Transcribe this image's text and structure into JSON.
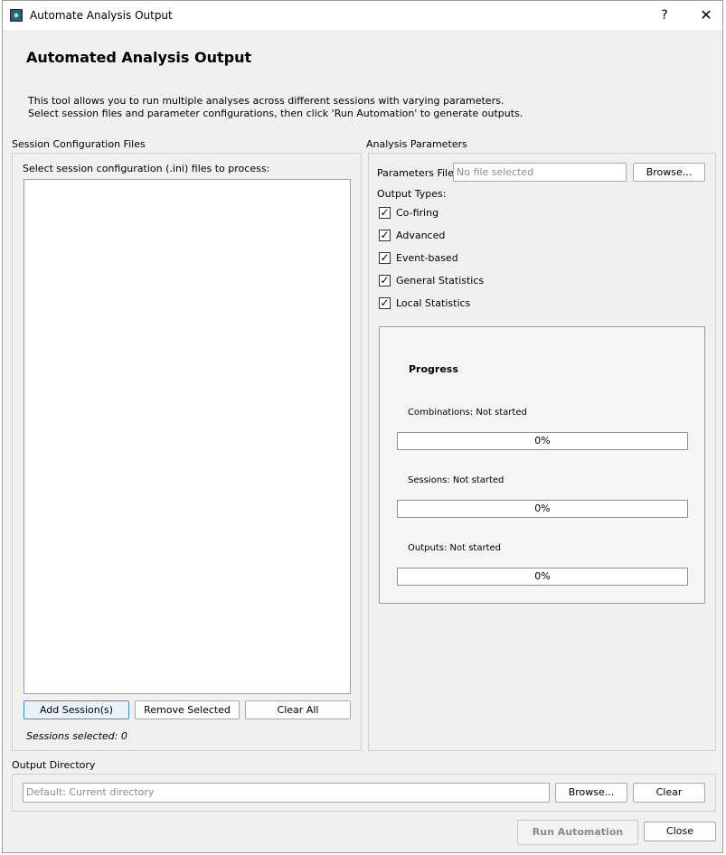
{
  "window": {
    "title": "Automate Analysis Output",
    "help_glyph": "?",
    "close_glyph": "✕"
  },
  "header": {
    "title": "Automated Analysis Output",
    "description_line1": "This tool allows you to run multiple analyses across different sessions with varying parameters.",
    "description_line2": "Select session files and parameter configurations, then click 'Run Automation' to generate outputs."
  },
  "sessions": {
    "group_label": "Session Configuration Files",
    "prompt": "Select session configuration (.ini) files to process:",
    "add_label": "Add Session(s)",
    "remove_label": "Remove Selected",
    "clear_label": "Clear All",
    "count_text": "Sessions selected: 0"
  },
  "analysis": {
    "group_label": "Analysis Parameters",
    "params_label": "Parameters File:",
    "params_placeholder": "No file selected",
    "browse_label": "Browse...",
    "output_types_label": "Output Types:",
    "output_types": [
      {
        "label": "Co-firing",
        "checked": true
      },
      {
        "label": "Advanced",
        "checked": true
      },
      {
        "label": "Event-based",
        "checked": true
      },
      {
        "label": "General Statistics",
        "checked": true
      },
      {
        "label": "Local Statistics",
        "checked": true
      }
    ],
    "check_glyph": "✓"
  },
  "progress": {
    "title": "Progress",
    "items": [
      {
        "label": "Combinations: Not started",
        "value": 0,
        "percent_text": "0%"
      },
      {
        "label": "Sessions: Not started",
        "value": 0,
        "percent_text": "0%"
      },
      {
        "label": "Outputs: Not started",
        "value": 0,
        "percent_text": "0%"
      }
    ]
  },
  "output_dir": {
    "group_label": "Output Directory",
    "placeholder": "Default: Current directory",
    "browse_label": "Browse...",
    "clear_label": "Clear"
  },
  "footer": {
    "run_label": "Run Automation",
    "close_label": "Close"
  },
  "colors": {
    "accent": "#3a8fd8",
    "progress_fill": "#06b025",
    "window_bg": "#f0f0f0"
  }
}
